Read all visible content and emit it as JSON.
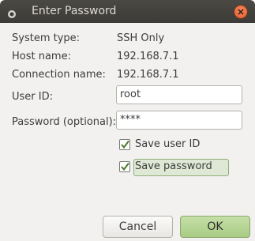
{
  "window": {
    "title": "Enter Password"
  },
  "info": {
    "system_type_label": "System type:",
    "system_type_value": "SSH Only",
    "host_name_label": "Host name:",
    "host_name_value": "192.168.7.1",
    "connection_name_label": "Connection name:",
    "connection_name_value": "192.168.7.1"
  },
  "form": {
    "user_id_label": "User ID:",
    "user_id_value": "root",
    "password_label": "Password (optional):",
    "password_value": "****",
    "save_user_id_label": "Save user ID",
    "save_user_id_checked": true,
    "save_password_label": "Save password",
    "save_password_checked": true
  },
  "buttons": {
    "cancel_label": "Cancel",
    "ok_label": "OK"
  },
  "colors": {
    "titlebar": "#3c3b37",
    "title_text": "#dfdbd2",
    "close_button": "#e05a2b",
    "background": "#f2f1f0",
    "check_accent": "#4e7a2c",
    "ok_button": "#a9cc84"
  },
  "icons": {
    "app": "app-icon",
    "close": "close-icon",
    "check": "checkmark-icon"
  }
}
